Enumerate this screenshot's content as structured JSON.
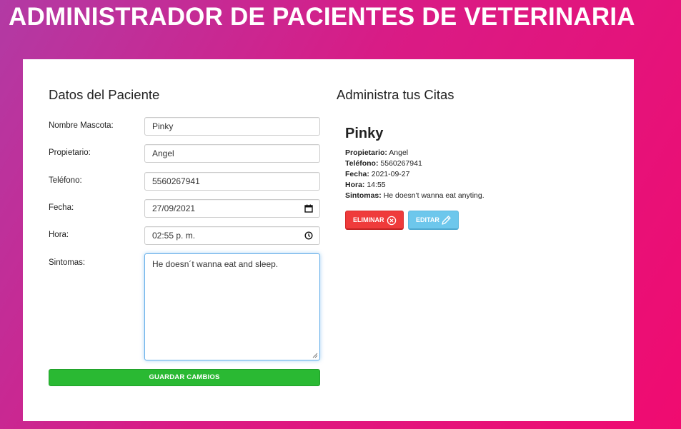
{
  "header": {
    "title": "ADMINISTRADOR DE PACIENTES DE VETERINARIA"
  },
  "form": {
    "title": "Datos del Paciente",
    "pet_label": "Nombre Mascota:",
    "pet_value": "Pinky",
    "owner_label": "Propietario:",
    "owner_value": "Angel",
    "phone_label": "Teléfono:",
    "phone_value": "5560267941",
    "date_label": "Fecha:",
    "date_value": "27/09/2021",
    "time_label": "Hora:",
    "time_value": "02:55 p. m.",
    "symptoms_label": "Sintomas:",
    "symptoms_value": "He doesn´t wanna eat and sleep.",
    "save_label": "GUARDAR CAMBIOS",
    "icons": {
      "date": "calendar-icon",
      "time": "clock-icon"
    }
  },
  "appointments": {
    "title": "Administra tus Citas",
    "items": [
      {
        "pet": "Pinky",
        "owner_label": "Propietario:",
        "owner": "Angel",
        "phone_label": "Teléfono:",
        "phone": "5560267941",
        "date_label": "Fecha:",
        "date": "2021-09-27",
        "time_label": "Hora:",
        "time": "14:55",
        "symptoms_label": "Sintomas:",
        "symptoms": "He doesn't wanna eat anyting.",
        "delete_label": "ELIMINAR",
        "edit_label": "EDITAR"
      }
    ]
  },
  "colors": {
    "save_button": "#2ab933",
    "delete_button": "#ef3b3b",
    "edit_button": "#6dc7ec",
    "background_start": "#b23aa4",
    "background_end": "#f00b70"
  }
}
